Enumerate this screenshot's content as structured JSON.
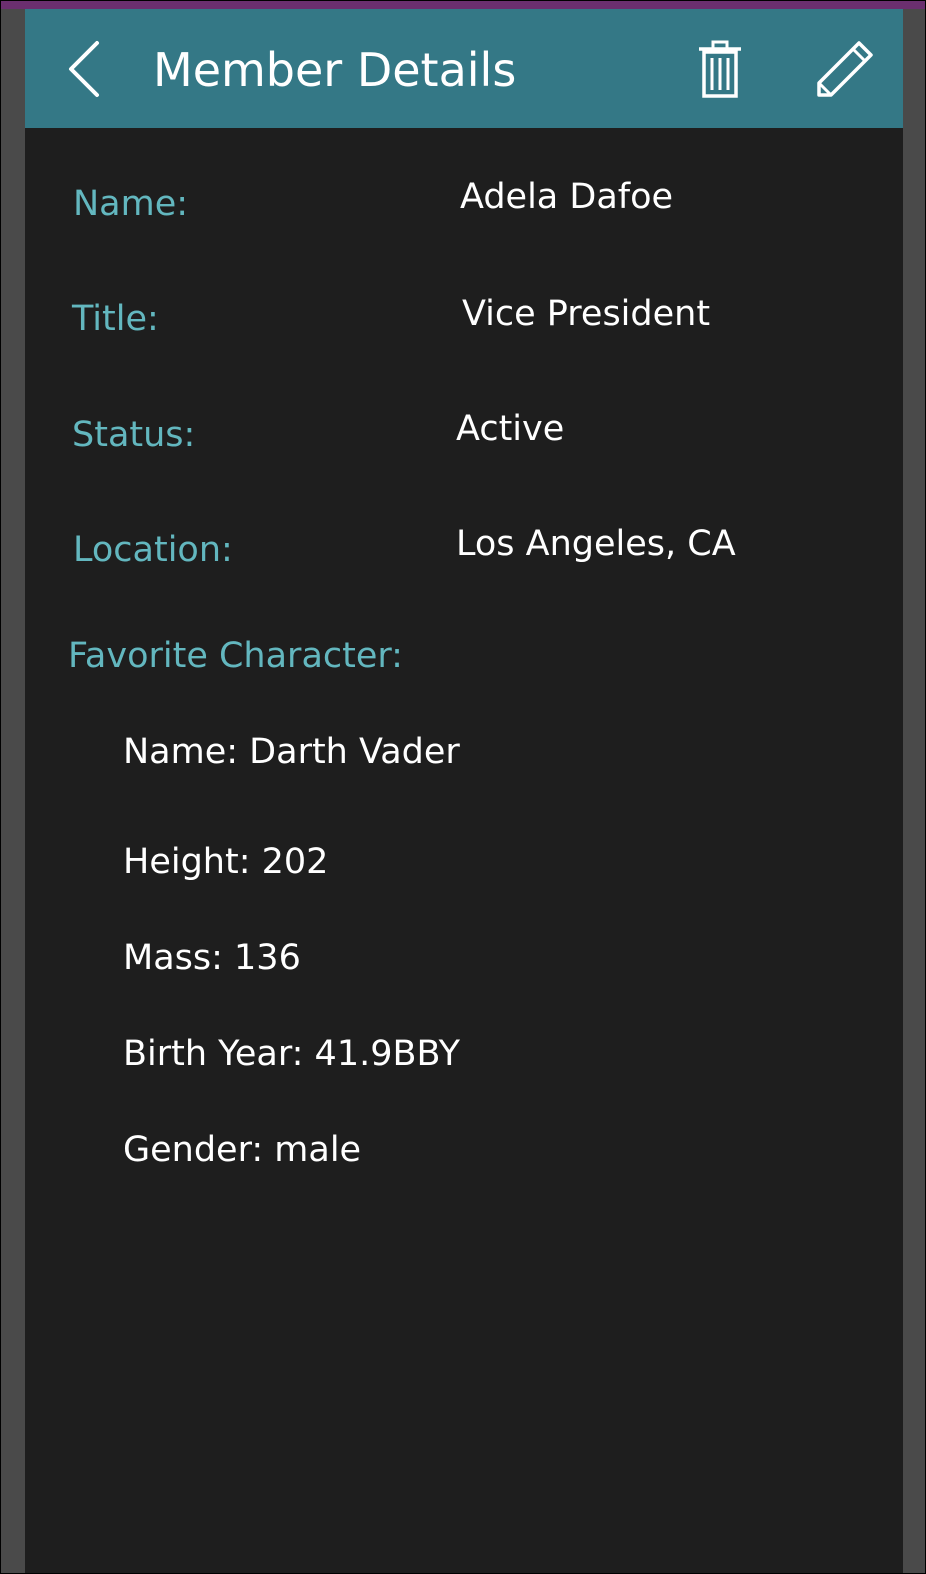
{
  "header": {
    "title": "Member Details",
    "back_icon": "chevron-left-icon",
    "delete_icon": "trash-icon",
    "edit_icon": "pencil-icon"
  },
  "fields": {
    "name": {
      "label": "Name:",
      "value": "Adela Dafoe"
    },
    "title": {
      "label": "Title:",
      "value": "Vice President"
    },
    "status": {
      "label": "Status:",
      "value": "Active"
    },
    "location": {
      "label": "Location:",
      "value": "Los Angeles, CA"
    }
  },
  "favorite_character": {
    "label": "Favorite Character:",
    "name": "Name: Darth Vader",
    "height": "Height: 202",
    "mass": "Mass: 136",
    "birth_year": "Birth Year: 41.9BBY",
    "gender": "Gender: male"
  },
  "colors": {
    "header_bg": "#347886",
    "body_bg": "#1e1e1e",
    "label_color": "#63b7bf",
    "value_color": "#ffffff"
  }
}
